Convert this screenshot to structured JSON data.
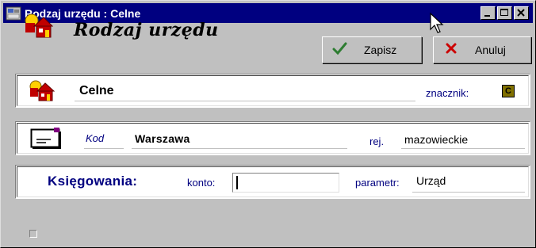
{
  "window": {
    "title": "Rodzaj urzędu : Celne"
  },
  "header": {
    "title": "Rodzaj urzędu"
  },
  "toolbar": {
    "save_label": "Zapisz",
    "cancel_label": "Anuluj"
  },
  "record": {
    "name": "Celne",
    "tag_label": "znacznik:",
    "tag_value": "C"
  },
  "address": {
    "kod_label": "Kod",
    "city": "Warszawa",
    "rej_label": "rej.",
    "region": "mazowieckie"
  },
  "accounting": {
    "title": "Księgowania:",
    "konto_label": "konto:",
    "konto_value": "",
    "param_label": "parametr:",
    "param_value": "Urząd"
  },
  "colors": {
    "titlebar": "#000080",
    "label": "#000080",
    "face": "#c0c0c0",
    "save_check": "#2e7d32",
    "cancel_x": "#cc0000"
  },
  "icons": [
    "office-building-icon",
    "minimize-icon",
    "maximize-icon",
    "close-icon",
    "checkmark-icon",
    "cancel-x-icon",
    "envelope-icon",
    "mouse-cursor-icon"
  ]
}
